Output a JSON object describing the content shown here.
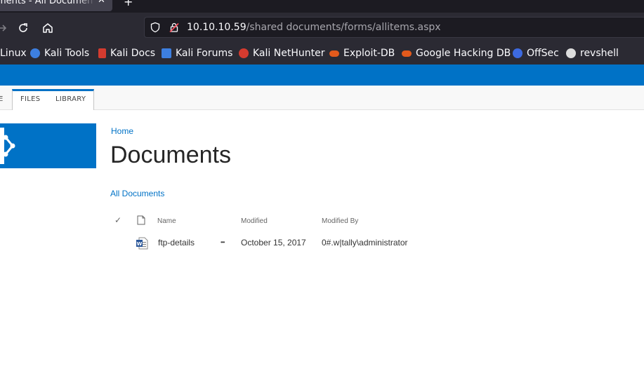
{
  "browser": {
    "tab_title": "ments - All Documen",
    "tab_close": "✕",
    "new_tab": "+",
    "url_host": "10.10.10.59",
    "url_path": "/shared documents/forms/allitems.aspx"
  },
  "bookmarks": [
    {
      "label": "Linux",
      "color": "#2b2a33"
    },
    {
      "label": "Kali Tools",
      "color": "#3d7fe0"
    },
    {
      "label": "Kali Docs",
      "color": "#d43b2f"
    },
    {
      "label": "Kali Forums",
      "color": "#3d7fe0"
    },
    {
      "label": "Kali NetHunter",
      "color": "#d43b2f"
    },
    {
      "label": "Exploit-DB",
      "color": "#e35a1c"
    },
    {
      "label": "Google Hacking DB",
      "color": "#e35a1c"
    },
    {
      "label": "OffSec",
      "color": "#3d6ae0"
    },
    {
      "label": "revshell",
      "color": "#dddddd"
    }
  ],
  "ribbon": {
    "cut_tab": "E",
    "files_tab": "FILES",
    "library_tab": "LIBRARY"
  },
  "colors": {
    "accent": "#0072c6"
  },
  "page": {
    "breadcrumb": "Home",
    "title": "Documents",
    "view_link": "All Documents"
  },
  "list": {
    "headers": {
      "check": "✓",
      "name": "Name",
      "modified": "Modified",
      "modified_by": "Modified By"
    },
    "rows": [
      {
        "name": "ftp-details",
        "ellipsis": "•••",
        "modified": "October 15, 2017",
        "modified_by": "0#.w|tally\\administrator"
      }
    ]
  }
}
